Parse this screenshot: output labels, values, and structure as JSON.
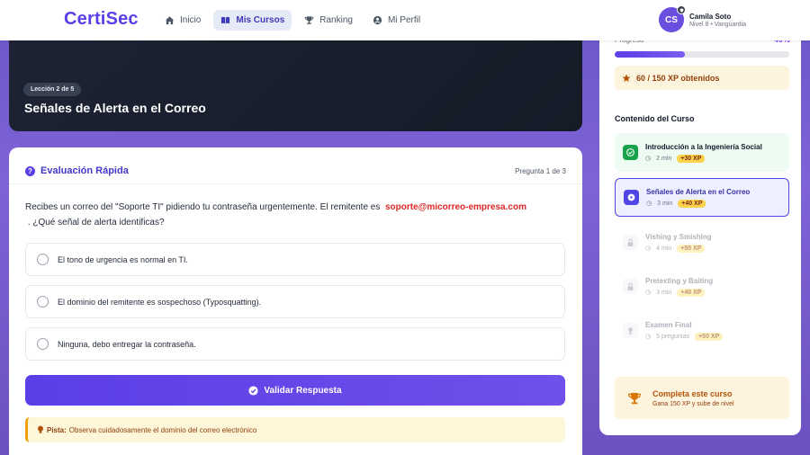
{
  "app": {
    "logo": "CertiSec"
  },
  "nav": {
    "items": [
      {
        "label": "Inicio",
        "icon": "home-icon",
        "active": false
      },
      {
        "label": "Mis Cursos",
        "icon": "book-icon",
        "active": true
      },
      {
        "label": "Ranking",
        "icon": "trophy-icon",
        "active": false
      },
      {
        "label": "Mi Perfil",
        "icon": "user-icon",
        "active": false
      }
    ]
  },
  "user": {
    "initials": "CS",
    "name": "Camila Soto",
    "level": "Nivel 8 • Vanguardia"
  },
  "hero": {
    "lesson_pill": "Lección 2 de 5",
    "title": "Señales de Alerta en el Correo"
  },
  "quiz": {
    "title": "Evaluación Rápida",
    "counter": "Pregunta 1 de 3",
    "question_before": "Recibes un correo del \"Soporte TI\" pidiendo tu contraseña urgentemente. El remitente es",
    "question_email": "soporte@micorreo-empresa.com",
    "question_after": ". ¿Qué señal de alerta identificas?",
    "options": [
      "El tono de urgencia es normal en TI.",
      "El dominio del remitente es sospechoso (Typosquatting).",
      "Ninguna, debo entregar la contraseña."
    ],
    "validate_label": "Validar Respuesta",
    "hint_label": "Pista:",
    "hint_text": "Observa cuidadosamente el dominio del correo electrónico"
  },
  "sidebar": {
    "progress_label": "Progreso",
    "progress_pct": "40%",
    "progress_value": 0.4,
    "xp_text": "60 / 150 XP obtenidos",
    "content_title": "Contenido del Curso",
    "lessons": [
      {
        "name": "Introducción a la Ingeniería Social",
        "time": "2 min",
        "xp": "+30 XP",
        "state": "done"
      },
      {
        "name": "Señales de Alerta en el Correo",
        "time": "3 min",
        "xp": "+40 XP",
        "state": "current"
      },
      {
        "name": "Vishing y Smishing",
        "time": "4 min",
        "xp": "+50 XP",
        "state": "locked"
      },
      {
        "name": "Pretexting y Baiting",
        "time": "3 min",
        "xp": "+40 XP",
        "state": "locked"
      },
      {
        "name": "Examen Final",
        "time": "5 preguntas",
        "xp": "+50 XP",
        "state": "locked"
      }
    ],
    "complete_title": "Completa este curso",
    "complete_sub": "Gana 150 XP y sube de nivel"
  },
  "colors": {
    "brand": "#5b3ee6",
    "danger": "#dc2626",
    "success": "#16a34a",
    "gold": "#f59e0b"
  }
}
